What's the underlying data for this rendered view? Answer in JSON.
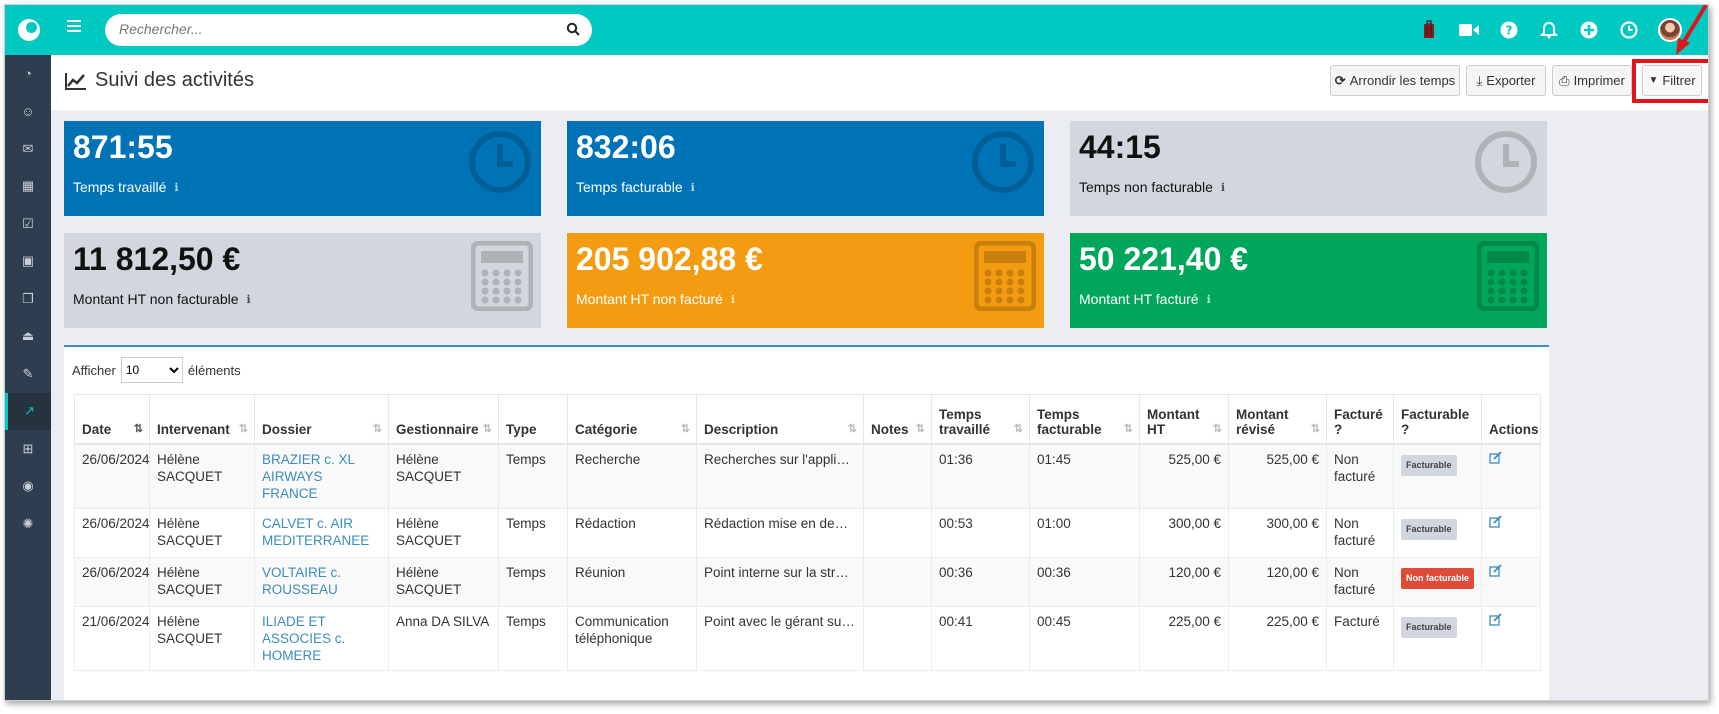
{
  "topbar": {
    "search_placeholder": "Rechercher...",
    "icons": [
      "suitcase-icon",
      "video-icon",
      "help-icon",
      "bell-icon",
      "plus-circle-icon",
      "clock-icon"
    ]
  },
  "sidebar": {
    "items": [
      "dashboard-icon",
      "contacts-icon",
      "mail-icon",
      "calendar-icon",
      "tasks-icon",
      "briefcase-icon",
      "documents-icon",
      "billing-icon",
      "notes-icon",
      "activity-chart-icon",
      "table-icon",
      "rss-icon",
      "network-icon"
    ],
    "active": "activity-chart-icon"
  },
  "header": {
    "title": "Suivi des activités",
    "buttons": {
      "round": "Arrondir les temps",
      "export": "Exporter",
      "print": "Imprimer",
      "filter": "Filtrer"
    }
  },
  "cards": [
    {
      "value": "871:55",
      "label": "Temps travaillé",
      "color": "#0073b7"
    },
    {
      "value": "832:06",
      "label": "Temps facturable",
      "color": "#0073b7"
    },
    {
      "value": "44:15",
      "label": "Temps non facturable",
      "color": "#d2d6de"
    },
    {
      "value": "11 812,50 €",
      "label": "Montant HT non facturable",
      "color": "#d2d6de"
    },
    {
      "value": "205 902,88 €",
      "label": "Montant HT non facturé",
      "color": "#f39c12"
    },
    {
      "value": "50 221,40 €",
      "label": "Montant HT facturé",
      "color": "#00a65a"
    }
  ],
  "table": {
    "show_label": "Afficher",
    "show_value": "10",
    "show_suffix": "éléments",
    "headers": [
      "Date",
      "Intervenant",
      "Dossier",
      "Gestionnaire",
      "Type",
      "Catégorie",
      "Description",
      "Notes",
      "Temps travaillé",
      "Temps facturable",
      "Montant HT",
      "Montant révisé",
      "Facturé ?",
      "Facturable ?",
      "Actions"
    ],
    "rows": [
      {
        "date": "26/06/2024",
        "intervenant": "Hélène SACQUET",
        "dossier": "BRAZIER c. XL AIRWAYS FRANCE",
        "gestionnaire": "Hélène SACQUET",
        "type": "Temps",
        "categorie": "Recherche",
        "description": "Recherches sur l'applicabilité",
        "notes": "",
        "travaille": "01:36",
        "facturable": "01:45",
        "ht": "525,00 €",
        "revise": "525,00 €",
        "facture": "Non facturé",
        "badge": "Facturable",
        "badge_type": "ok"
      },
      {
        "date": "26/06/2024",
        "intervenant": "Hélène SACQUET",
        "dossier": "CALVET c. AIR MEDITERRANEE",
        "gestionnaire": "Hélène SACQUET",
        "type": "Temps",
        "categorie": "Rédaction",
        "description": "Rédaction mise en demeure",
        "notes": "",
        "travaille": "00:53",
        "facturable": "01:00",
        "ht": "300,00 €",
        "revise": "300,00 €",
        "facture": "Non facturé",
        "badge": "Facturable",
        "badge_type": "ok"
      },
      {
        "date": "26/06/2024",
        "intervenant": "Hélène SACQUET",
        "dossier": "VOLTAIRE c. ROUSSEAU",
        "gestionnaire": "Hélène SACQUET",
        "type": "Temps",
        "categorie": "Réunion",
        "description": "Point interne sur la stratégie",
        "notes": "",
        "travaille": "00:36",
        "facturable": "00:36",
        "ht": "120,00 €",
        "revise": "120,00 €",
        "facture": "Non facturé",
        "badge": "Non facturable",
        "badge_type": "no"
      },
      {
        "date": "21/06/2024",
        "intervenant": "Hélène SACQUET",
        "dossier": "ILIADE ET ASSOCIES c. HOMERE",
        "gestionnaire": "Anna DA SILVA",
        "type": "Temps",
        "categorie": "Communication téléphonique",
        "description": "Point avec le gérant sur l'affaire",
        "notes": "",
        "travaille": "00:41",
        "facturable": "00:45",
        "ht": "225,00 €",
        "revise": "225,00 €",
        "facture": "Facturé",
        "badge": "Facturable",
        "badge_type": "ok"
      }
    ]
  },
  "colors": {
    "accent": "#00c9c1",
    "sidebar": "#2f3e4e",
    "link": "#3c8dbc",
    "highlight": "#e1141a"
  }
}
